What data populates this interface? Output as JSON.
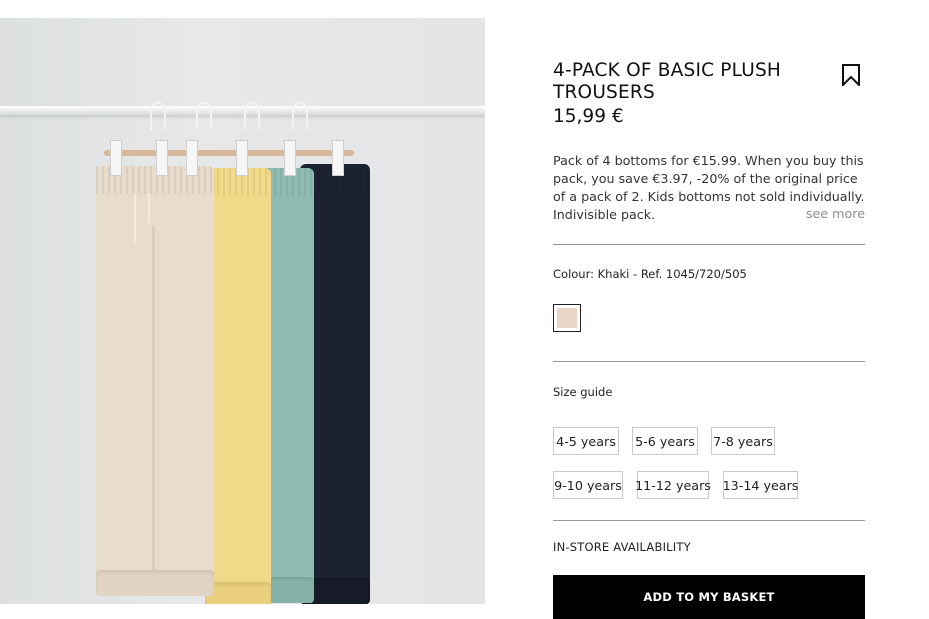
{
  "product": {
    "title": "4-PACK OF BASIC PLUSH TROUSERS",
    "price": "15,99 €",
    "description": "Pack of 4 bottoms for €15.99. When you buy this pack, you save €3.97, -20% of the original price of a pack of 2. Kids bottoms not sold individually. Indivisible pack.",
    "see_more": "see more",
    "bookmark_icon": "bookmark-icon"
  },
  "colour": {
    "label": "Colour: Khaki - Ref. 1045/720/505",
    "swatch_color": "#ead6c7"
  },
  "sizes": {
    "guide_label": "Size guide",
    "options": [
      "4-5 years",
      "5-6 years",
      "7-8 years",
      "9-10 years",
      "11-12 years",
      "13-14 years"
    ]
  },
  "availability_label": "IN-STORE AVAILABILITY",
  "add_button_label": "ADD TO MY BASKET",
  "image": {
    "garment_colors": [
      "#e8dccb",
      "#f1d98a",
      "#8fbcb2",
      "#1c2230"
    ]
  }
}
